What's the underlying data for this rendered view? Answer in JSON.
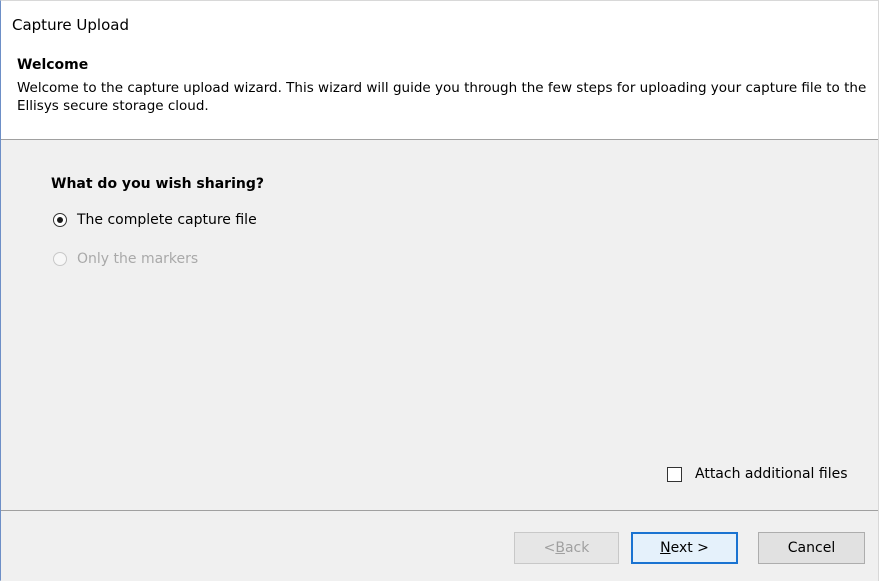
{
  "window": {
    "title": "Capture Upload"
  },
  "header": {
    "heading": "Welcome",
    "description": "Welcome to the capture upload wizard.  This wizard will guide you through the few steps for uploading your capture file to the Ellisys secure storage cloud."
  },
  "main": {
    "question": "What do you wish sharing?",
    "options": [
      {
        "label": "The complete capture file",
        "selected": true,
        "enabled": true
      },
      {
        "label": "Only the markers",
        "selected": false,
        "enabled": false
      }
    ],
    "attach_checkbox": {
      "label": "Attach additional files",
      "checked": false
    }
  },
  "footer": {
    "back": {
      "prefix": "< ",
      "accel": "B",
      "rest": "ack",
      "enabled": false
    },
    "next": {
      "accel": "N",
      "rest": "ext >",
      "enabled": true
    },
    "cancel": {
      "label": "Cancel"
    }
  },
  "colors": {
    "accent": "#1a73d1",
    "disabled_text": "#a9a9a9"
  }
}
